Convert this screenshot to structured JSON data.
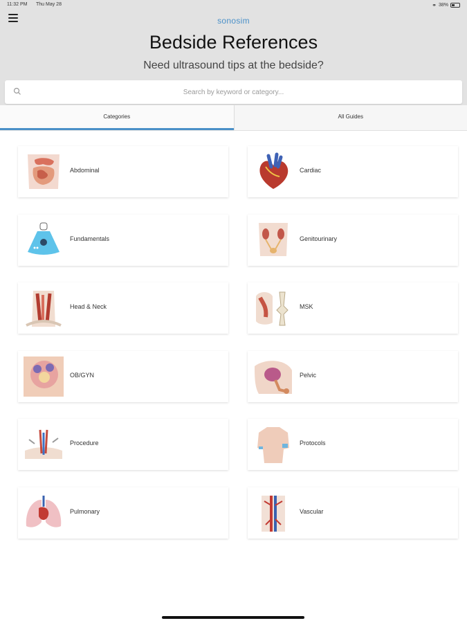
{
  "status_bar": {
    "time": "11:32 PM",
    "date": "Thu May 28",
    "battery": "38%"
  },
  "header": {
    "logo": "sonosim",
    "title": "Bedside References",
    "subtitle": "Need ultrasound tips at the bedside?"
  },
  "search": {
    "placeholder": "Search by keyword or category..."
  },
  "tabs": [
    {
      "label": "Categories",
      "active": true
    },
    {
      "label": "All Guides",
      "active": false
    }
  ],
  "categories": [
    {
      "label": "Abdominal",
      "icon": "abdominal-anatomy-icon"
    },
    {
      "label": "Cardiac",
      "icon": "heart-anatomy-icon"
    },
    {
      "label": "Fundamentals",
      "icon": "ultrasound-beam-icon"
    },
    {
      "label": "Genitourinary",
      "icon": "genitourinary-anatomy-icon"
    },
    {
      "label": "Head & Neck",
      "icon": "head-neck-anatomy-icon"
    },
    {
      "label": "MSK",
      "icon": "musculoskeletal-anatomy-icon"
    },
    {
      "label": "OB/GYN",
      "icon": "obgyn-anatomy-icon"
    },
    {
      "label": "Pelvic",
      "icon": "pelvic-anatomy-icon"
    },
    {
      "label": "Procedure",
      "icon": "procedure-anatomy-icon"
    },
    {
      "label": "Protocols",
      "icon": "torso-protocols-icon"
    },
    {
      "label": "Pulmonary",
      "icon": "lungs-anatomy-icon"
    },
    {
      "label": "Vascular",
      "icon": "vascular-anatomy-icon"
    }
  ],
  "colors": {
    "accent": "#4a90c8",
    "header_bg": "#e2e2e2"
  }
}
